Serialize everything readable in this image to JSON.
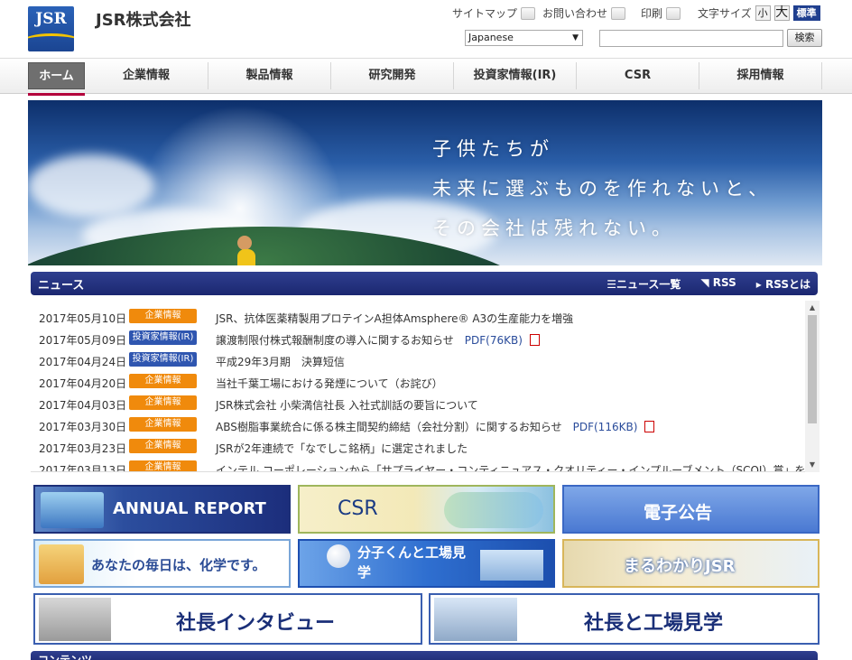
{
  "header": {
    "logo_text": "JSR",
    "company_name": "JSR株式会社",
    "utility": {
      "sitemap": "サイトマップ",
      "contact": "お問い合わせ",
      "print": "印刷",
      "font_size_label": "文字サイズ",
      "font_small": "小",
      "font_large": "大",
      "font_standard": "標準"
    },
    "language": "Japanese",
    "search_placeholder": "",
    "search_button": "検索"
  },
  "nav": {
    "items": [
      "ホーム",
      "企業情報",
      "製品情報",
      "研究開発",
      "投資家情報(IR)",
      "CSR",
      "採用情報"
    ],
    "active": "ホーム"
  },
  "hero": {
    "line1": "子供たちが",
    "line2": "未来に選ぶものを作れないと、",
    "line3": "その会社は残れない。"
  },
  "news": {
    "title": "ニュース",
    "link_list": "ニュース一覧",
    "link_rss": "RSS",
    "link_rss_about": "RSSとは",
    "items": [
      {
        "date": "2017年05月10日",
        "category": "企業情報",
        "text": "JSR、抗体医薬精製用プロテインA担体Amsphere® A3の生産能力を増強",
        "pdf": ""
      },
      {
        "date": "2017年05月09日",
        "category": "投資家情報(IR)",
        "text": "譲渡制限付株式報酬制度の導入に関するお知らせ",
        "pdf": "PDF(76KB)"
      },
      {
        "date": "2017年04月24日",
        "category": "投資家情報(IR)",
        "text": "平成29年3月期　決算短信",
        "pdf": ""
      },
      {
        "date": "2017年04月20日",
        "category": "企業情報",
        "text": "当社千葉工場における発煙について（お詫び）",
        "pdf": ""
      },
      {
        "date": "2017年04月03日",
        "category": "企業情報",
        "text": "JSR株式会社 小柴満信社長 入社式訓話の要旨について",
        "pdf": ""
      },
      {
        "date": "2017年03月30日",
        "category": "企業情報",
        "text": "ABS樹脂事業統合に係る株主間契約締結（会社分割）に関するお知らせ",
        "pdf": "PDF(116KB)"
      },
      {
        "date": "2017年03月23日",
        "category": "企業情報",
        "text": "JSRが2年連続で「なでしこ銘柄」に選定されました",
        "pdf": ""
      },
      {
        "date": "2017年03月13日",
        "category": "企業情報",
        "text": "インテル コーポレーションから「サプライヤー・コンティニュアス・クオリティー・インプルーブメント（SCQI）賞」を受賞",
        "pdf": ""
      }
    ],
    "category_colors": {
      "企業情報": "#f08a0c",
      "投資家情報(IR)": "#2f56b0"
    }
  },
  "banners": {
    "annual_report": "ANNUAL REPORT",
    "csr": "CSR",
    "koukoku": "電子公告",
    "mainichi": "あなたの毎日は、化学です。",
    "bunshi": "分子くんと工場見学",
    "maruwakari": "まるわかりJSR",
    "interview": "社長インタビュー",
    "kengaku": "社長と工場見学"
  },
  "bottom_section_title": "コンテンツ"
}
